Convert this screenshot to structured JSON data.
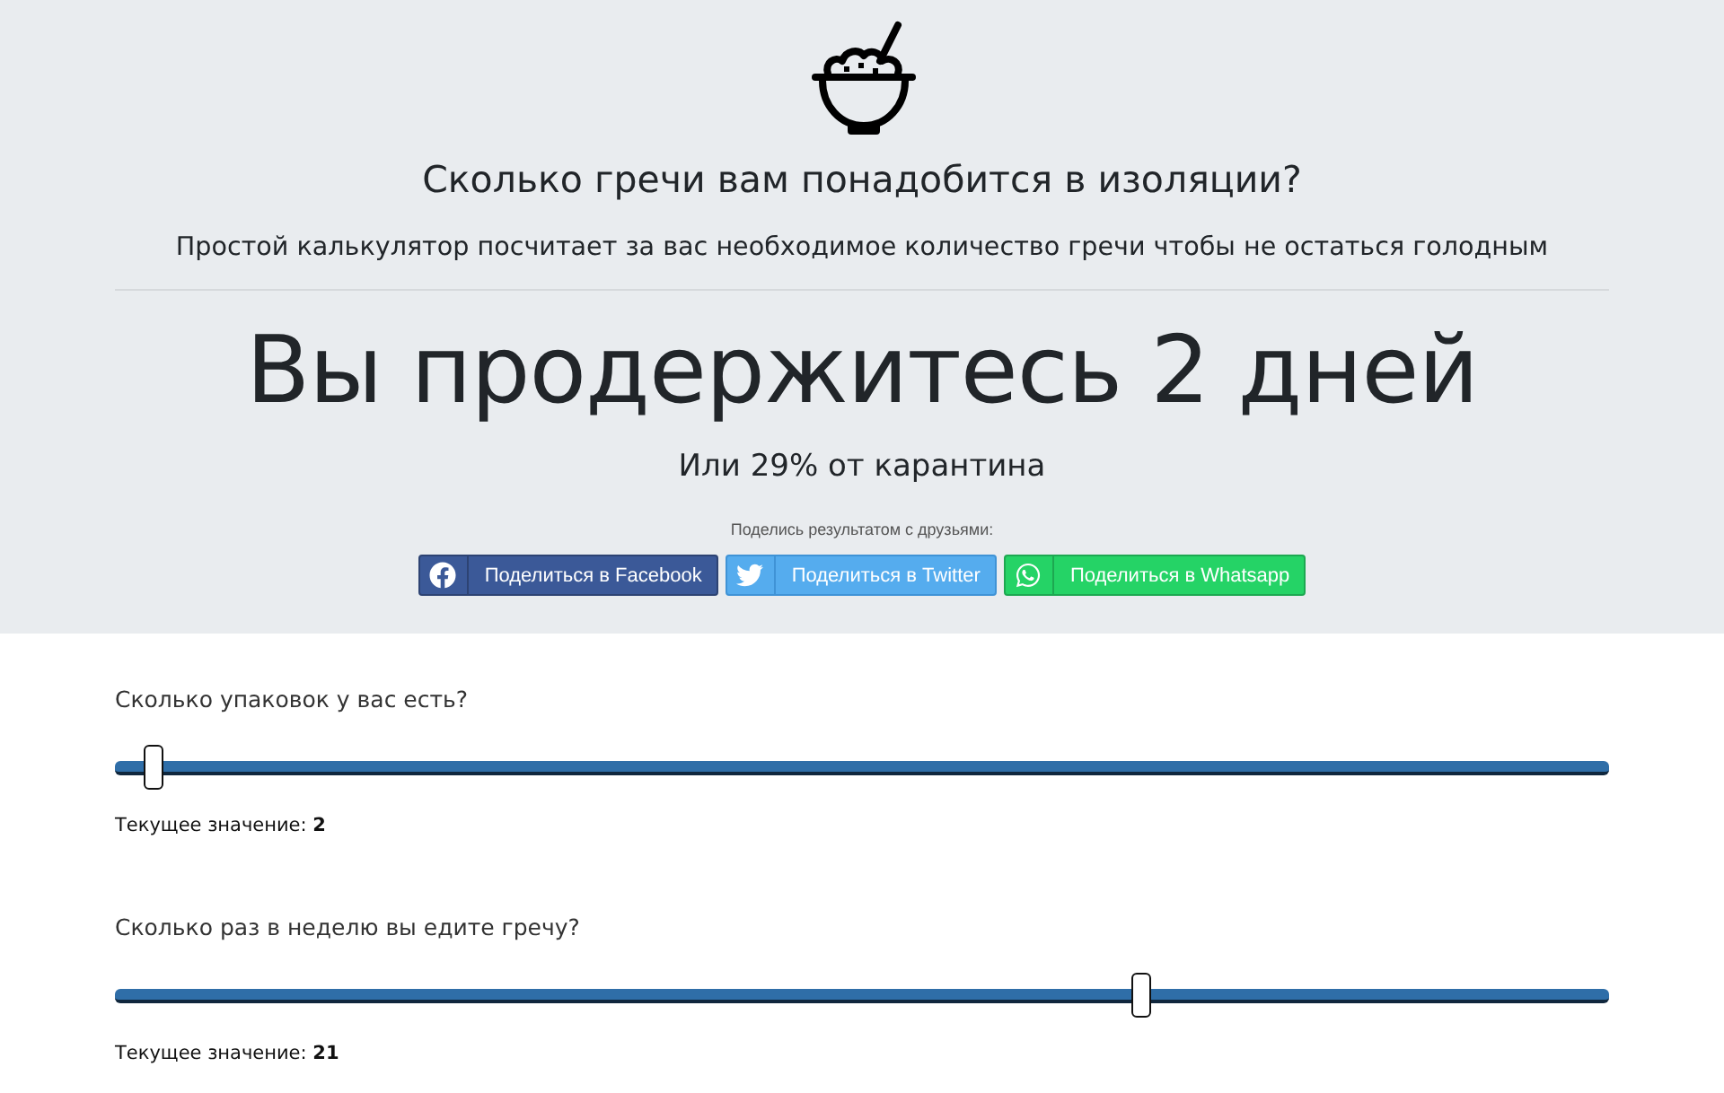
{
  "header": {
    "title": "Сколько гречи вам понадобится в изоляции?",
    "subtitle": "Простой калькулятор посчитает за вас необходимое количество гречи чтобы не остаться голодным"
  },
  "result": {
    "headline": "Вы продержитесь 2 дней",
    "subline": "Или 29% от карантина"
  },
  "share": {
    "caption": "Поделись результатом с друзьями:",
    "buttons": [
      {
        "kind": "facebook",
        "label": "Поделиться в Facebook"
      },
      {
        "kind": "twitter",
        "label": "Поделиться в Twitter"
      },
      {
        "kind": "whatsapp",
        "label": "Поделиться в Whatsapp"
      }
    ]
  },
  "sliders": [
    {
      "question": "Сколько упаковок у вас есть?",
      "level": 0.02,
      "reading": "Текущее значение: **2**"
    },
    {
      "question": "Сколько раз в неделю вы едите гречу?",
      "level": 0.69,
      "reading": "Текущее значение: **21**"
    }
  ]
}
